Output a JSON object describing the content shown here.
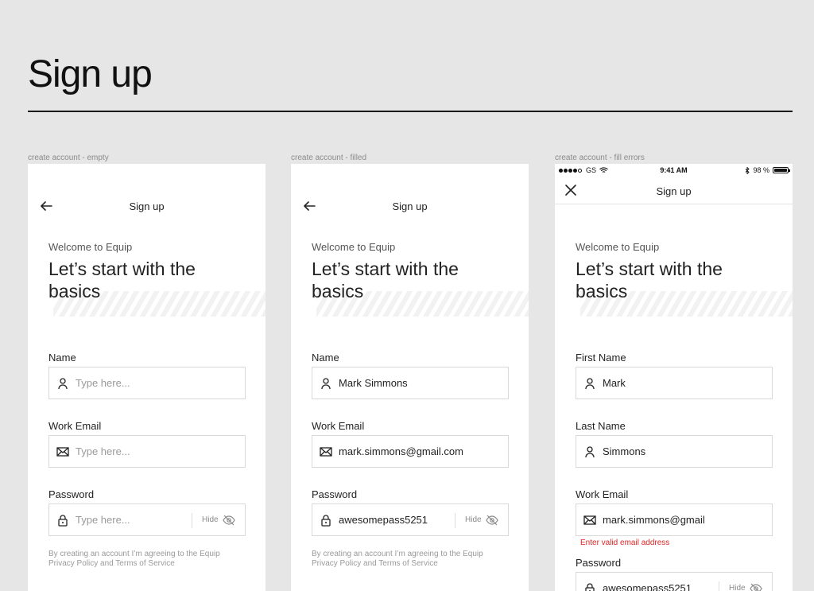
{
  "page": {
    "title": "Sign up"
  },
  "frames": [
    {
      "caption": "create account - empty",
      "nav_title": "Sign up",
      "welcome": "Welcome to Equip",
      "headline": "Let’s start with the basics",
      "fields": {
        "name": {
          "label": "Name",
          "placeholder": "Type here..."
        },
        "email": {
          "label": "Work Email",
          "placeholder": "Type here..."
        },
        "password": {
          "label": "Password",
          "placeholder": "Type here...",
          "hide_label": "Hide"
        }
      },
      "legal": "By creating an account I’m agreeing to the Equip Privacy Policy and Terms of Service"
    },
    {
      "caption": "create account - filled",
      "nav_title": "Sign up",
      "welcome": "Welcome to Equip",
      "headline": "Let’s start with the basics",
      "fields": {
        "name": {
          "label": "Name",
          "value": "Mark Simmons"
        },
        "email": {
          "label": "Work Email",
          "value": "mark.simmons@gmail.com"
        },
        "password": {
          "label": "Password",
          "value": "awesomepass5251",
          "hide_label": "Hide"
        }
      },
      "legal": "By creating an account I’m agreeing to the Equip Privacy Policy and Terms of Service"
    },
    {
      "caption": "create account - fill errors",
      "status_bar": {
        "carrier": "GS",
        "time": "9:41 AM",
        "battery": "98 %"
      },
      "nav_title": "Sign up",
      "welcome": "Welcome to Equip",
      "headline": "Let’s start with the basics",
      "fields": {
        "first_name": {
          "label": "First Name",
          "value": "Mark"
        },
        "last_name": {
          "label": "Last Name",
          "value": "Simmons"
        },
        "email": {
          "label": "Work Email",
          "value": "mark.simmons@gmail",
          "error": "Enter valid email address"
        },
        "password": {
          "label": "Password",
          "value": "awesomepass5251",
          "hide_label": "Hide"
        }
      }
    }
  ]
}
